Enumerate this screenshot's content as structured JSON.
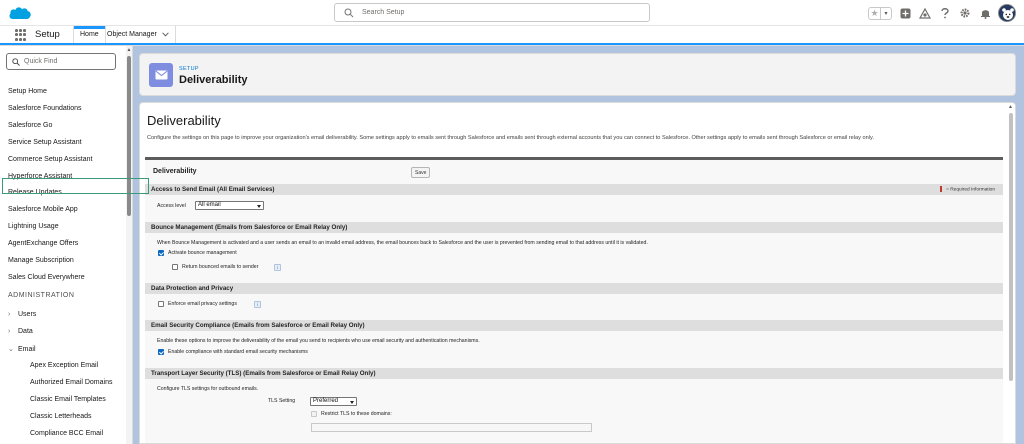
{
  "global_header": {
    "search_placeholder": "Search Setup",
    "icons": [
      "favorites-star-icon",
      "favorites-list-icon",
      "add-icon",
      "trailhead-icon",
      "help-icon",
      "setup-gear-icon",
      "notifications-bell-icon",
      "user-avatar"
    ]
  },
  "context_bar": {
    "app_name": "Setup",
    "tabs": [
      {
        "label": "Home",
        "active": true
      },
      {
        "label": "Object Manager",
        "active": false
      }
    ]
  },
  "sidebar": {
    "quick_find_placeholder": "Quick Find",
    "items": [
      "Setup Home",
      "Salesforce Foundations",
      "Salesforce Go",
      "Service Setup Assistant",
      "Commerce Setup Assistant",
      "Hyperforce Assistant",
      "Release Updates",
      "Salesforce Mobile App",
      "Lightning Usage",
      "AgentExchange Offers",
      "Manage Subscription",
      "Sales Cloud Everywhere"
    ],
    "section_label": "ADMINISTRATION",
    "tree": [
      {
        "label": "Users",
        "expanded": false
      },
      {
        "label": "Data",
        "expanded": false
      },
      {
        "label": "Email",
        "expanded": true
      }
    ],
    "email_children": [
      "Apex Exception Email",
      "Authorized Email Domains",
      "Classic Email Templates",
      "Classic Letterheads",
      "Compliance BCC Email"
    ]
  },
  "page_header": {
    "eyebrow": "SETUP",
    "title": "Deliverability"
  },
  "content": {
    "title": "Deliverability",
    "description": "Configure the settings on this page to improve your organization's email deliverability. Some settings apply to emails sent through Salesforce and emails sent through external accounts that you can connect to Salesforce. Other settings apply to emails sent through Salesforce or email relay only.",
    "block_title": "Deliverability",
    "save_label": "Save",
    "required_info": "= Required Information",
    "sections": {
      "access": {
        "title": "Access to Send Email (All Email Services)",
        "access_level_label": "Access level",
        "access_level_value": "All email"
      },
      "bounce": {
        "title": "Bounce Management (Emails from Salesforce or Email Relay Only)",
        "desc": "When Bounce Management is activated and a user sends an email to an invalid email address, the email bounces back to Salesforce and the user is prevented from sending email to that address until it is validated.",
        "activate_label": "Activate bounce management",
        "activate_checked": true,
        "return_label": "Return bounced emails to sender",
        "return_checked": false
      },
      "privacy": {
        "title": "Data Protection and Privacy",
        "enforce_label": "Enforce email privacy settings",
        "enforce_checked": false
      },
      "security": {
        "title": "Email Security Compliance (Emails from Salesforce or Email Relay Only)",
        "desc": "Enable these options to improve the deliverability of the email you send to recipients who use email security and authentication mechanisms.",
        "compliance_label": "Enable compliance with standard email security mechanisms",
        "compliance_checked": true
      },
      "tls": {
        "title": "Transport Layer Security (TLS) (Emails from Salesforce or Email Relay Only)",
        "desc": "Configure TLS settings for outbound emails.",
        "setting_label": "TLS Setting",
        "setting_value": "Preferred",
        "restrict_label": "Restrict TLS to these domains:",
        "restrict_checked": false
      }
    },
    "info_glyph": "i"
  },
  "colors": {
    "accent_blue": "#1b96ff",
    "checkbox_blue": "#0b67c2",
    "page_icon": "#7f8de1",
    "highlight_green": "#3b9b78",
    "required_red": "#c23934",
    "main_bg": "#b0c4df"
  }
}
